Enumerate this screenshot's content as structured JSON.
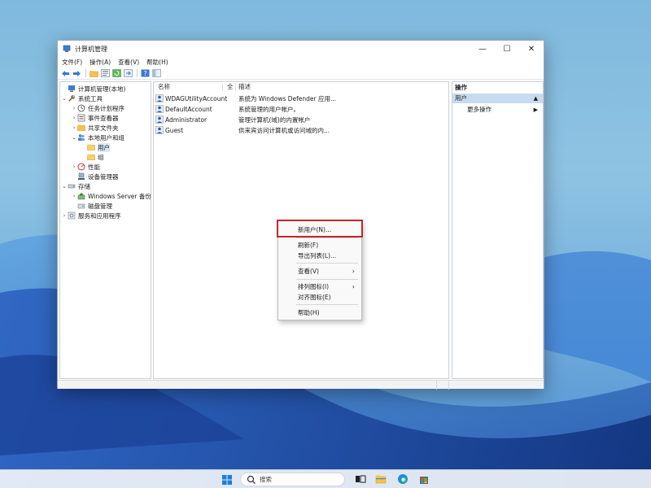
{
  "window": {
    "title": "计算机管理",
    "controls": {
      "minimize": "—",
      "maximize": "☐",
      "close": "✕"
    }
  },
  "menubar": [
    "文件(F)",
    "操作(A)",
    "查看(V)",
    "帮助(H)"
  ],
  "toolbar_icons": [
    "back-arrow-icon",
    "forward-arrow-icon",
    "folder-up-icon",
    "properties-icon",
    "refresh-icon",
    "export-list-icon",
    "help-icon",
    "console-view-icon"
  ],
  "tree": {
    "root": "计算机管理(本地)",
    "system_tools": "系统工具",
    "task_scheduler": "任务计划程序",
    "event_viewer": "事件查看器",
    "shared_folders": "共享文件夹",
    "local_users_groups": "本地用户和组",
    "users": "用户",
    "groups": "组",
    "performance": "性能",
    "device_manager": "设备管理器",
    "storage": "存储",
    "windows_server_backup": "Windows Server 备份",
    "disk_management": "磁盘管理",
    "services_apps": "服务和应用程序"
  },
  "list": {
    "columns": {
      "name": "名称",
      "full_name": "全",
      "description": "描述"
    },
    "rows": [
      {
        "name": "WDAGUtilityAccount",
        "description": "系统为 Windows Defender 应用..."
      },
      {
        "name": "DefaultAccount",
        "description": "系统管理的用户帐户。"
      },
      {
        "name": "Administrator",
        "description": "管理计算机(域)的内置帐户"
      },
      {
        "name": "Guest",
        "description": "供来宾访问计算机或访问域的内..."
      }
    ]
  },
  "actions": {
    "header": "操作",
    "section": "用户",
    "more": "更多操作"
  },
  "context_menu": {
    "new_user": "新用户(N)...",
    "refresh": "刷新(F)",
    "export_list": "导出列表(L)...",
    "view": "查看(V)",
    "arrange_icons": "排列图标(I)",
    "line_up_icons": "对齐图标(E)",
    "help": "帮助(H)"
  },
  "taskbar": {
    "search_label": "搜索",
    "apps": [
      "start-icon",
      "task-view-icon",
      "file-explorer-icon",
      "edge-icon",
      "store-icon"
    ]
  },
  "colors": {
    "selection": "#c7dbee",
    "highlight_box": "#c0282a",
    "window_bg": "#ffffff"
  }
}
